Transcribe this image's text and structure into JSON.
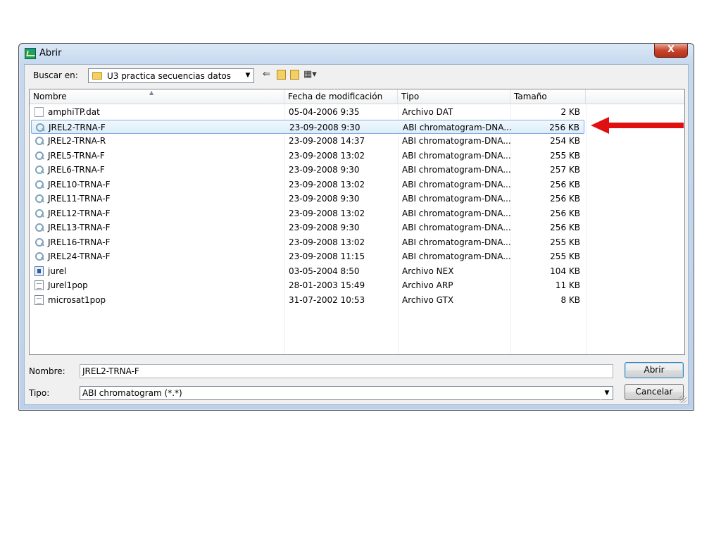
{
  "window": {
    "title": "Abrir",
    "close_label": "X"
  },
  "toolbar": {
    "lookin_label": "Buscar en:",
    "lookin_value": "U3 practica secuencias datos",
    "icons": [
      "back-arrow-icon",
      "up-folder-icon",
      "new-folder-icon",
      "view-menu-icon"
    ]
  },
  "columns": {
    "name": "Nombre",
    "modified": "Fecha de modificación",
    "type": "Tipo",
    "size": "Tamaño"
  },
  "files": [
    {
      "name": "amphiTP.dat",
      "modified": "05-04-2006 9:35",
      "type": "Archivo DAT",
      "size": "2 KB",
      "icon": "dat"
    },
    {
      "name": "JREL2-TRNA-F",
      "modified": "23-09-2008 9:30",
      "type": "ABI chromatogram-DNA...",
      "size": "256 KB",
      "icon": "abi"
    },
    {
      "name": "JREL2-TRNA-R",
      "modified": "23-09-2008 14:37",
      "type": "ABI chromatogram-DNA...",
      "size": "254 KB",
      "icon": "abi"
    },
    {
      "name": "JREL5-TRNA-F",
      "modified": "23-09-2008 13:02",
      "type": "ABI chromatogram-DNA...",
      "size": "255 KB",
      "icon": "abi"
    },
    {
      "name": "JREL6-TRNA-F",
      "modified": "23-09-2008 9:30",
      "type": "ABI chromatogram-DNA...",
      "size": "257 KB",
      "icon": "abi"
    },
    {
      "name": "JREL10-TRNA-F",
      "modified": "23-09-2008 13:02",
      "type": "ABI chromatogram-DNA...",
      "size": "256 KB",
      "icon": "abi"
    },
    {
      "name": "JREL11-TRNA-F",
      "modified": "23-09-2008 9:30",
      "type": "ABI chromatogram-DNA...",
      "size": "256 KB",
      "icon": "abi"
    },
    {
      "name": "JREL12-TRNA-F",
      "modified": "23-09-2008 13:02",
      "type": "ABI chromatogram-DNA...",
      "size": "256 KB",
      "icon": "abi"
    },
    {
      "name": "JREL13-TRNA-F",
      "modified": "23-09-2008 9:30",
      "type": "ABI chromatogram-DNA...",
      "size": "256 KB",
      "icon": "abi"
    },
    {
      "name": "JREL16-TRNA-F",
      "modified": "23-09-2008 13:02",
      "type": "ABI chromatogram-DNA...",
      "size": "255 KB",
      "icon": "abi"
    },
    {
      "name": "JREL24-TRNA-F",
      "modified": "23-09-2008 11:15",
      "type": "ABI chromatogram-DNA...",
      "size": "255 KB",
      "icon": "abi"
    },
    {
      "name": "jurel",
      "modified": "03-05-2004 8:50",
      "type": "Archivo NEX",
      "size": "104 KB",
      "icon": "nex"
    },
    {
      "name": "Jurel1pop",
      "modified": "28-01-2003 15:49",
      "type": "Archivo ARP",
      "size": "11 KB",
      "icon": "txt"
    },
    {
      "name": "microsat1pop",
      "modified": "31-07-2002 10:53",
      "type": "Archivo GTX",
      "size": "8 KB",
      "icon": "txt"
    }
  ],
  "selected_index": 1,
  "bottom": {
    "name_label": "Nombre:",
    "name_value": "JREL2-TRNA-F",
    "type_label": "Tipo:",
    "type_value": "ABI chromatogram (*.*)",
    "open_button": "Abrir",
    "cancel_button": "Cancelar"
  },
  "annotation": {
    "arrow_color": "#e01010"
  }
}
